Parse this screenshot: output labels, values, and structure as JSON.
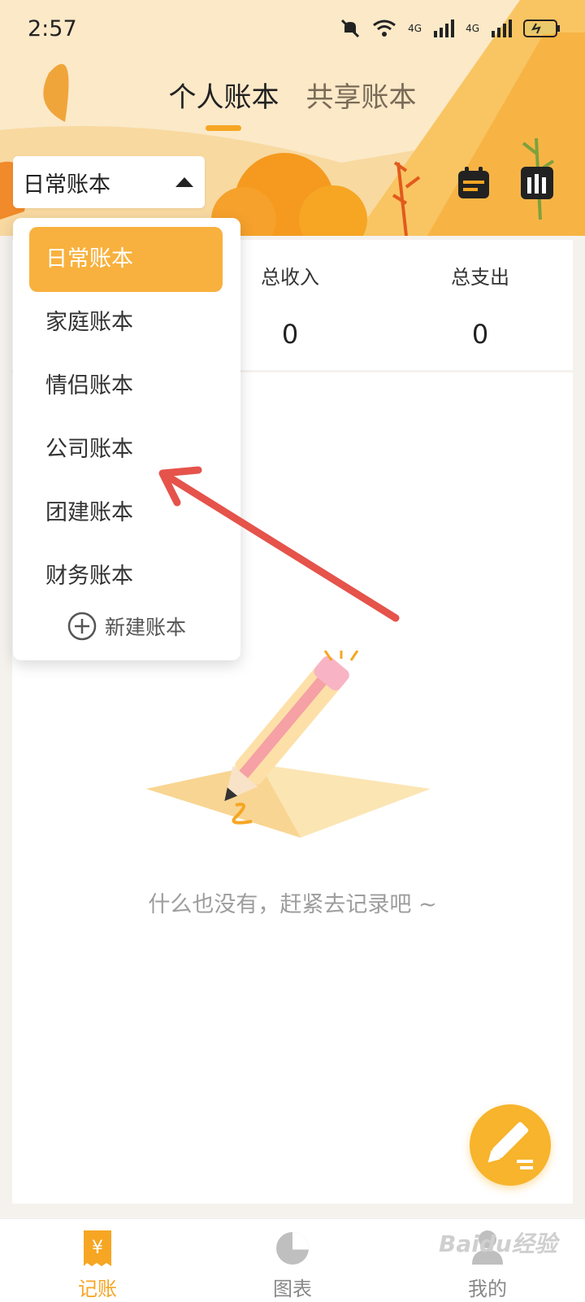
{
  "status_bar": {
    "time": "2:57",
    "signal_1": "4G",
    "signal_2": "4G"
  },
  "header": {
    "tabs": [
      {
        "label": "个人账本"
      },
      {
        "label": "共享账本"
      }
    ]
  },
  "book_selector": {
    "label": "日常账本"
  },
  "summary": {
    "income_label": "总收入",
    "income_value": "0",
    "expense_label": "总支出",
    "expense_value": "0"
  },
  "dropdown": {
    "items": [
      {
        "label": "日常账本"
      },
      {
        "label": "家庭账本"
      },
      {
        "label": "情侣账本"
      },
      {
        "label": "公司账本"
      },
      {
        "label": "团建账本"
      },
      {
        "label": "财务账本"
      }
    ],
    "new_book_label": "新建账本"
  },
  "empty_state": {
    "text": "什么也没有，赶紧去记录吧 ~"
  },
  "bottom_nav": {
    "items": [
      {
        "label": "记账"
      },
      {
        "label": "图表"
      },
      {
        "label": "我的"
      }
    ]
  },
  "watermark": {
    "text": "Baidu经验"
  },
  "colors": {
    "accent": "#f6a623",
    "selected_item": "#f8b13e",
    "arrow": "#e5534b"
  }
}
